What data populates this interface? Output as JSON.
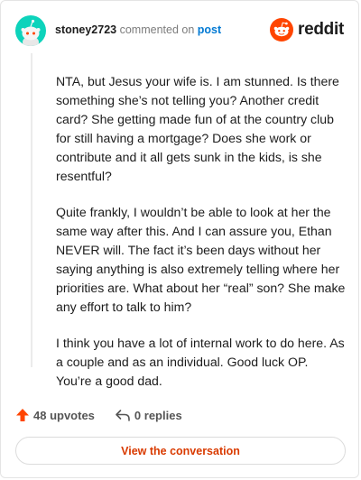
{
  "header": {
    "username": "stoney2723",
    "action_text": "commented on",
    "post_link_label": "post",
    "brand_name": "reddit"
  },
  "comment": {
    "paragraphs": [
      "NTA, but Jesus your wife is. I am stunned. Is there something she’s not telling you? Another credit card? She getting made fun of at the country club for still having a mortgage? Does she work or contribute and it all gets sunk in the kids, is she resentful?",
      "Quite frankly, I wouldn’t be able to look at her the same way after this. And I can assure you, Ethan NEVER will. The fact it’s been days without her saying anything is also extremely telling where her priorities are. What about her “real” son? She make any effort to talk to him?",
      "I think you have a lot of internal work to do here. As a couple and as an individual. Good luck OP. You’re a good dad."
    ]
  },
  "stats": {
    "upvotes_label": "48 upvotes",
    "replies_label": "0 replies"
  },
  "cta": {
    "label": "View the conversation"
  },
  "colors": {
    "brand": "#ff4500",
    "link": "#0079d3",
    "cta_text": "#d93a00",
    "avatar_bg": "#0dd3bb"
  },
  "icons": [
    "avatar-snoo-icon",
    "reddit-logo-icon",
    "upvote-arrow-icon",
    "reply-arrow-icon"
  ]
}
